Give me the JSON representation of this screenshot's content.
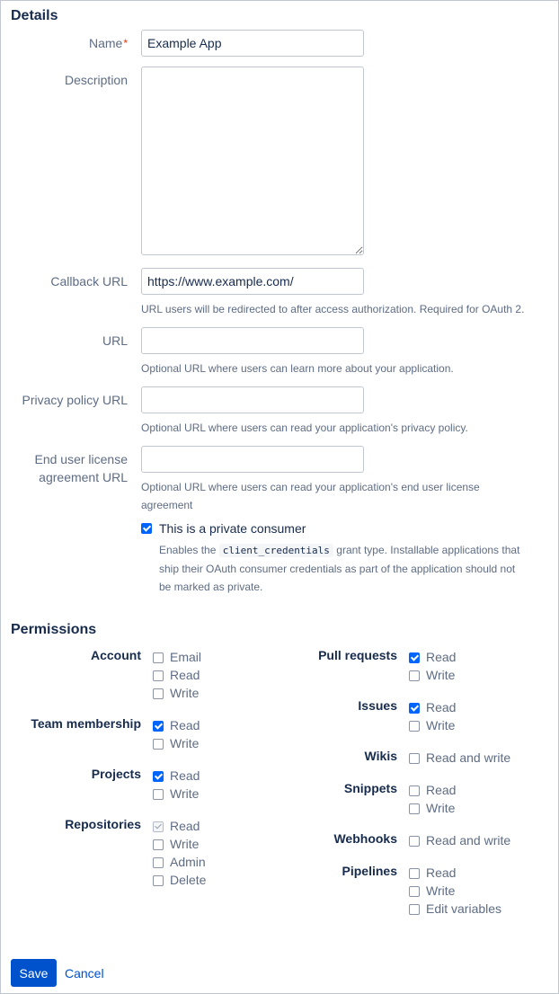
{
  "details": {
    "heading": "Details",
    "name_label": "Name",
    "name_required": "*",
    "name_value": "Example App",
    "description_label": "Description",
    "description_value": "",
    "callback_label": "Callback URL",
    "callback_value": "https://www.example.com/",
    "callback_help": "URL users will be redirected to after access authorization. Required for OAuth 2.",
    "url_label": "URL",
    "url_value": "",
    "url_help": "Optional URL where users can learn more about your application.",
    "privacy_label": "Privacy policy URL",
    "privacy_value": "",
    "privacy_help": "Optional URL where users can read your application's privacy policy.",
    "eula_label_line1": "End user license",
    "eula_label_line2": "agreement URL",
    "eula_value": "",
    "eula_help_line1": "Optional URL where users can read your application's end user license",
    "eula_help_line2": "agreement",
    "private_label": "This is a private consumer",
    "private_checked": true,
    "private_help_prefix": "Enables the ",
    "private_help_code": "client_credentials",
    "private_help_suffix": " grant type. Installable applications that",
    "private_help_line2": "ship their OAuth consumer credentials as part of the application should not",
    "private_help_line3": "be marked as private."
  },
  "permissions": {
    "heading": "Permissions",
    "account": {
      "label": "Account",
      "options": [
        {
          "label": "Email",
          "checked": false
        },
        {
          "label": "Read",
          "checked": false
        },
        {
          "label": "Write",
          "checked": false
        }
      ]
    },
    "team_membership": {
      "label": "Team membership",
      "options": [
        {
          "label": "Read",
          "checked": true
        },
        {
          "label": "Write",
          "checked": false
        }
      ]
    },
    "projects": {
      "label": "Projects",
      "options": [
        {
          "label": "Read",
          "checked": true
        },
        {
          "label": "Write",
          "checked": false
        }
      ]
    },
    "repositories": {
      "label": "Repositories",
      "options": [
        {
          "label": "Read",
          "checked": true,
          "disabled": true
        },
        {
          "label": "Write",
          "checked": false
        },
        {
          "label": "Admin",
          "checked": false
        },
        {
          "label": "Delete",
          "checked": false
        }
      ]
    },
    "pull_requests": {
      "label": "Pull requests",
      "options": [
        {
          "label": "Read",
          "checked": true
        },
        {
          "label": "Write",
          "checked": false
        }
      ]
    },
    "issues": {
      "label": "Issues",
      "options": [
        {
          "label": "Read",
          "checked": true
        },
        {
          "label": "Write",
          "checked": false
        }
      ]
    },
    "wikis": {
      "label": "Wikis",
      "options": [
        {
          "label": "Read and write",
          "checked": false
        }
      ]
    },
    "snippets": {
      "label": "Snippets",
      "options": [
        {
          "label": "Read",
          "checked": false
        },
        {
          "label": "Write",
          "checked": false
        }
      ]
    },
    "webhooks": {
      "label": "Webhooks",
      "options": [
        {
          "label": "Read and write",
          "checked": false
        }
      ]
    },
    "pipelines": {
      "label": "Pipelines",
      "options": [
        {
          "label": "Read",
          "checked": false
        },
        {
          "label": "Write",
          "checked": false
        },
        {
          "label": "Edit variables",
          "checked": false
        }
      ]
    }
  },
  "actions": {
    "save_label": "Save",
    "cancel_label": "Cancel"
  }
}
